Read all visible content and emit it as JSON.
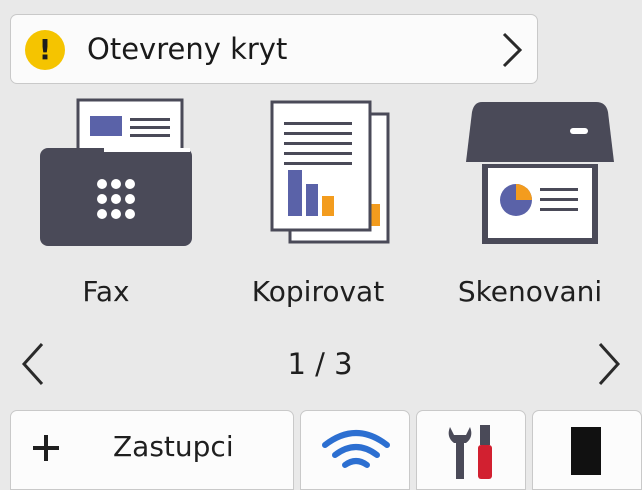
{
  "status_alert": {
    "text": "Otevreny kryt",
    "icon": "warning-icon",
    "icon_glyph": "!",
    "icon_color": "#f5c400"
  },
  "apps": [
    {
      "label": "Fax",
      "icon": "fax-icon"
    },
    {
      "label": "Kopirovat",
      "icon": "copy-icon"
    },
    {
      "label": "Skenovani",
      "icon": "scan-icon"
    }
  ],
  "pager": {
    "text": "1 / 3"
  },
  "bottom_bar": {
    "shortcuts_label": "Zastupci",
    "shortcuts_icon": "plus-icon",
    "wifi_icon": "wifi-icon",
    "settings_icon": "tools-icon",
    "toner_icon": "toner-icon"
  },
  "colors": {
    "icon_dark": "#4a4a58",
    "accent_blue": "#5a62a8",
    "accent_orange": "#f39c1e",
    "tool_red": "#d22030"
  }
}
